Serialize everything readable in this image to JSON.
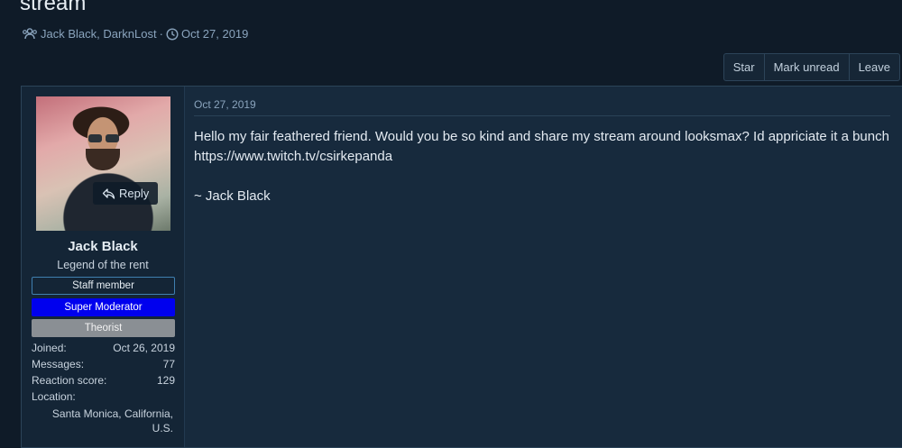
{
  "thread": {
    "title": "stream",
    "participants": "Jack Black, DarknLost",
    "separator": "·",
    "date": "Oct 27, 2019"
  },
  "actions": [
    "Star",
    "Mark unread",
    "Leave"
  ],
  "user": {
    "reply_label": "Reply",
    "name": "Jack Black",
    "title": "Legend of the rent",
    "banners": [
      "Staff member",
      "Super Moderator",
      "Theorist"
    ],
    "stats": {
      "joined_label": "Joined:",
      "joined_value": "Oct 26, 2019",
      "messages_label": "Messages:",
      "messages_value": "77",
      "reaction_label": "Reaction score:",
      "reaction_value": "129",
      "location_label": "Location:",
      "location_value": "Santa Monica, California, U.S."
    }
  },
  "post": {
    "date": "Oct 27, 2019",
    "body": "Hello my fair feathered friend. Would you be so kind and share my stream around looksmax? Id appriciate it a bunch https://www.twitch.tv/csirkepanda",
    "signature": "~ Jack Black"
  },
  "colors": {
    "background": "#0f1b28",
    "panel": "#172a3d",
    "super_moderator_banner": "#0000ee",
    "theorist_banner": "#8a8f94"
  }
}
